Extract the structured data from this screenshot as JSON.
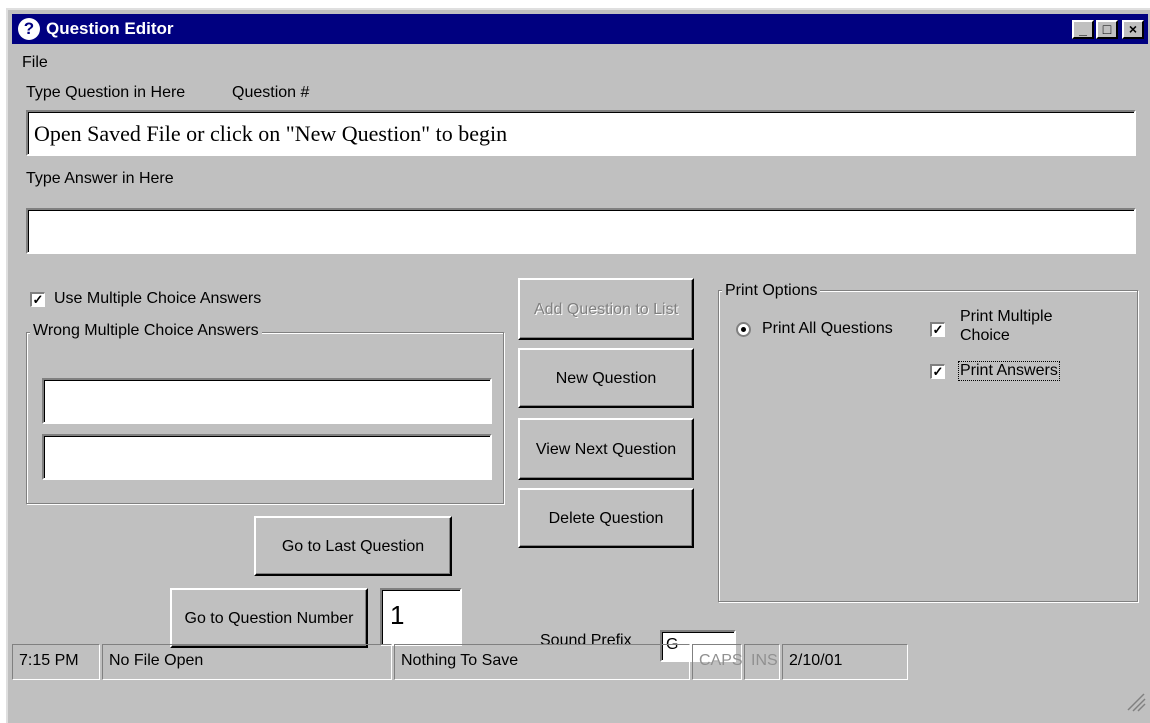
{
  "window": {
    "title": "Question Editor",
    "icon": "question-icon"
  },
  "menu": {
    "file": "File"
  },
  "question": {
    "label": "Type Question in Here",
    "number_label": "Question #",
    "value": "Open Saved File or click on \"New Question\" to begin"
  },
  "answer": {
    "label": "Type Answer in Here",
    "value": ""
  },
  "multiple_choice": {
    "label": "Use Multiple Choice Answers",
    "checked": true
  },
  "wrong_answers": {
    "label": "Wrong Multiple Choice Answers",
    "values": [
      "",
      ""
    ]
  },
  "buttons": {
    "add_question": "Add Question to List",
    "new_question": "New Question",
    "view_next": "View Next Question",
    "delete_question": "Delete Question",
    "go_last": "Go to Last Question",
    "go_number": "Go to Question Number"
  },
  "question_number_value": "1",
  "print_options": {
    "label": "Print Options",
    "all_questions": "Print All Questions",
    "multiple_choice": "Print Multiple Choice",
    "answers": "Print Answers"
  },
  "sound_prefix": {
    "label": "Sound Prefix",
    "value": "G"
  },
  "status": {
    "time": "7:15 PM",
    "file": "No File Open",
    "save": "Nothing To Save",
    "caps": "CAPS",
    "ins": "INS",
    "date": "2/10/01"
  }
}
